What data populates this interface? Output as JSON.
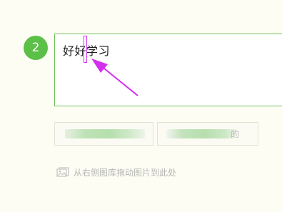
{
  "step": {
    "number": "2"
  },
  "answer": {
    "text": "好好学习"
  },
  "buttons": [
    {
      "label": ""
    },
    {
      "label": "的"
    }
  ],
  "drop_hint": {
    "text": "从右侧图库拖动图片到此处",
    "icon": "image-icon"
  },
  "colors": {
    "accent": "#5cbf47",
    "border": "#6cc05a",
    "arrow": "#d32ff0",
    "background": "#fdfdf3"
  }
}
